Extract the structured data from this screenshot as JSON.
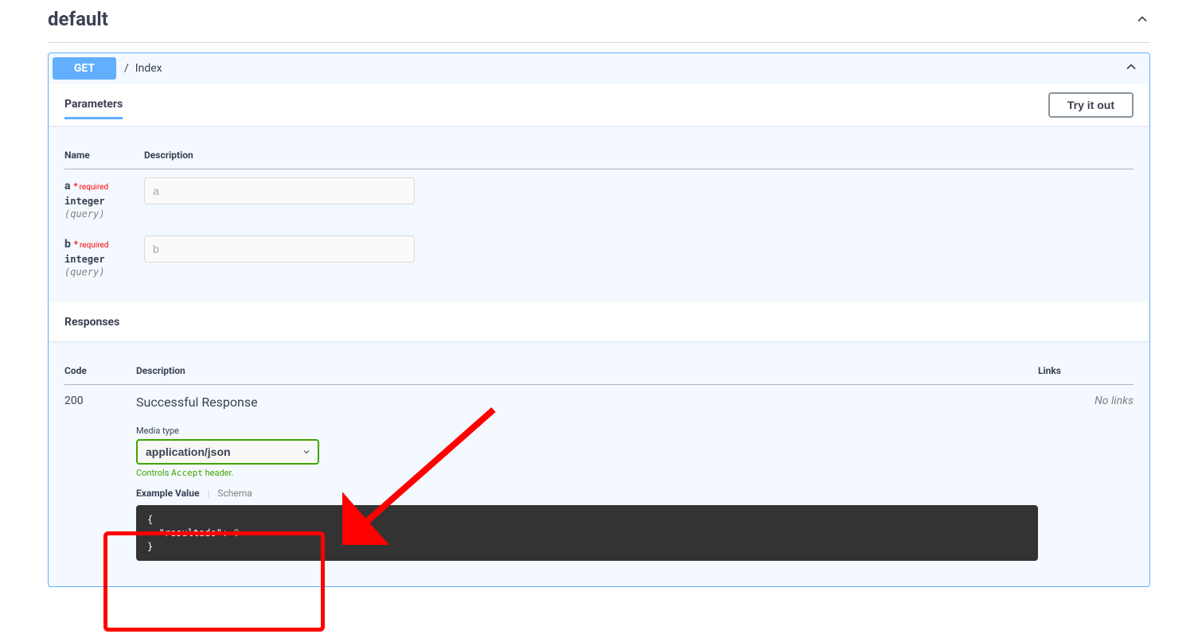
{
  "tag": {
    "name": "default"
  },
  "opblock": {
    "method": "GET",
    "slash": "/",
    "summary": "Index"
  },
  "parameters": {
    "tab_label": "Parameters",
    "try_label": "Try it out",
    "headers": {
      "name": "Name",
      "description": "Description"
    },
    "rows": [
      {
        "name": "a",
        "required": "required",
        "type": "integer",
        "in": "(query)",
        "placeholder": "a"
      },
      {
        "name": "b",
        "required": "required",
        "type": "integer",
        "in": "(query)",
        "placeholder": "b"
      }
    ]
  },
  "responses": {
    "header": "Responses",
    "columns": {
      "code": "Code",
      "description": "Description",
      "links": "Links"
    },
    "items": [
      {
        "code": "200",
        "description": "Successful Response",
        "media_label": "Media type",
        "media_value": "application/json",
        "accept_prefix": "Controls ",
        "accept_code": "Accept",
        "accept_suffix": " header.",
        "example_tab": "Example Value",
        "schema_tab": "Schema",
        "example_json": {
          "open": "{",
          "key": "\"resultado\"",
          "colon": ": ",
          "value": "0",
          "close": "}"
        },
        "links_text": "No links"
      }
    ]
  }
}
